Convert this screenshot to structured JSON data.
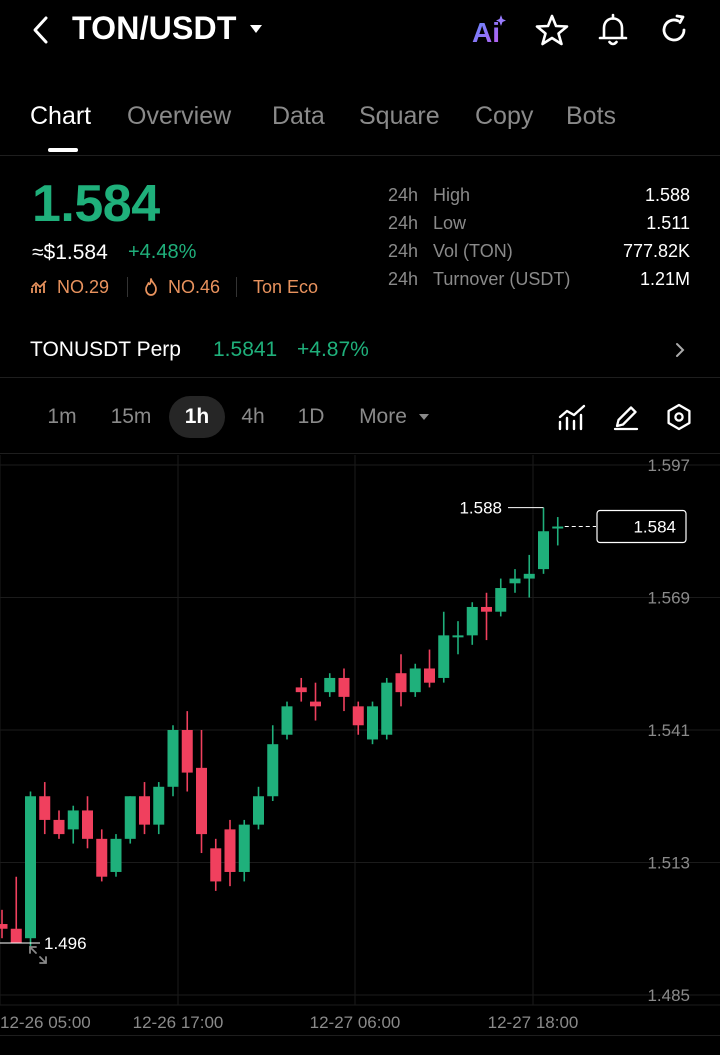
{
  "header": {
    "pair": "TON/USDT",
    "icons": [
      "back-icon",
      "caret-down-icon",
      "ai-icon",
      "star-icon",
      "bell-icon",
      "refresh-icon"
    ]
  },
  "tabs": [
    {
      "label": "Chart",
      "active": true
    },
    {
      "label": "Overview",
      "active": false
    },
    {
      "label": "Data",
      "active": false
    },
    {
      "label": "Square",
      "active": false
    },
    {
      "label": "Copy",
      "active": false
    },
    {
      "label": "Bots",
      "active": false
    }
  ],
  "ticker": {
    "price": "1.584",
    "usd": "≈$1.584",
    "change": "+4.48%",
    "rank1": "NO.29",
    "rank2": "NO.46",
    "tag": "Ton Eco",
    "stats": [
      {
        "period": "24h",
        "label": "High",
        "value": "1.588"
      },
      {
        "period": "24h",
        "label": "Low",
        "value": "1.511"
      },
      {
        "period": "24h",
        "label": "Vol (TON)",
        "value": "777.82K"
      },
      {
        "period": "24h",
        "label": "Turnover (USDT)",
        "value": "1.21M"
      }
    ]
  },
  "perp": {
    "name": "TONUSDT Perp",
    "price": "1.5841",
    "change": "+4.87%"
  },
  "intervals": [
    {
      "label": "1m",
      "active": false
    },
    {
      "label": "15m",
      "active": false
    },
    {
      "label": "1h",
      "active": true
    },
    {
      "label": "4h",
      "active": false
    },
    {
      "label": "1D",
      "active": false
    },
    {
      "label": "More",
      "active": false
    }
  ],
  "colors": {
    "up": "#1fb07b",
    "down": "#f0405e",
    "rank": "#e9935e",
    "ai": "#8a6cf5"
  },
  "chart_data": {
    "type": "candlestick",
    "x_ticks": [
      "12-26 05:00",
      "12-26 17:00",
      "12-27 06:00",
      "12-27 18:00"
    ],
    "y_ticks": [
      1.597,
      1.569,
      1.541,
      1.513,
      1.485
    ],
    "ylim": [
      1.485,
      1.597
    ],
    "high_label": "1.588",
    "low_label": "1.496",
    "last_price": "1.584",
    "candles": [
      {
        "o": 1.5,
        "h": 1.503,
        "l": 1.497,
        "c": 1.499
      },
      {
        "o": 1.499,
        "h": 1.51,
        "l": 1.496,
        "c": 1.496
      },
      {
        "o": 1.497,
        "h": 1.528,
        "l": 1.495,
        "c": 1.527
      },
      {
        "o": 1.527,
        "h": 1.53,
        "l": 1.519,
        "c": 1.522
      },
      {
        "o": 1.522,
        "h": 1.524,
        "l": 1.518,
        "c": 1.519
      },
      {
        "o": 1.52,
        "h": 1.525,
        "l": 1.517,
        "c": 1.524
      },
      {
        "o": 1.524,
        "h": 1.527,
        "l": 1.516,
        "c": 1.518
      },
      {
        "o": 1.518,
        "h": 1.52,
        "l": 1.509,
        "c": 1.51
      },
      {
        "o": 1.511,
        "h": 1.519,
        "l": 1.51,
        "c": 1.518
      },
      {
        "o": 1.518,
        "h": 1.527,
        "l": 1.517,
        "c": 1.527
      },
      {
        "o": 1.527,
        "h": 1.53,
        "l": 1.519,
        "c": 1.521
      },
      {
        "o": 1.521,
        "h": 1.53,
        "l": 1.519,
        "c": 1.529
      },
      {
        "o": 1.529,
        "h": 1.542,
        "l": 1.527,
        "c": 1.541
      },
      {
        "o": 1.541,
        "h": 1.545,
        "l": 1.528,
        "c": 1.532
      },
      {
        "o": 1.533,
        "h": 1.541,
        "l": 1.515,
        "c": 1.519
      },
      {
        "o": 1.516,
        "h": 1.518,
        "l": 1.507,
        "c": 1.509
      },
      {
        "o": 1.52,
        "h": 1.522,
        "l": 1.508,
        "c": 1.511
      },
      {
        "o": 1.511,
        "h": 1.522,
        "l": 1.509,
        "c": 1.521
      },
      {
        "o": 1.521,
        "h": 1.529,
        "l": 1.52,
        "c": 1.527
      },
      {
        "o": 1.527,
        "h": 1.542,
        "l": 1.526,
        "c": 1.538
      },
      {
        "o": 1.54,
        "h": 1.547,
        "l": 1.539,
        "c": 1.546
      },
      {
        "o": 1.55,
        "h": 1.552,
        "l": 1.547,
        "c": 1.549
      },
      {
        "o": 1.547,
        "h": 1.551,
        "l": 1.543,
        "c": 1.546
      },
      {
        "o": 1.549,
        "h": 1.553,
        "l": 1.548,
        "c": 1.552
      },
      {
        "o": 1.552,
        "h": 1.554,
        "l": 1.545,
        "c": 1.548
      },
      {
        "o": 1.546,
        "h": 1.547,
        "l": 1.54,
        "c": 1.542
      },
      {
        "o": 1.539,
        "h": 1.547,
        "l": 1.538,
        "c": 1.546
      },
      {
        "o": 1.54,
        "h": 1.552,
        "l": 1.539,
        "c": 1.551
      },
      {
        "o": 1.553,
        "h": 1.557,
        "l": 1.546,
        "c": 1.549
      },
      {
        "o": 1.549,
        "h": 1.555,
        "l": 1.548,
        "c": 1.554
      },
      {
        "o": 1.554,
        "h": 1.558,
        "l": 1.55,
        "c": 1.551
      },
      {
        "o": 1.552,
        "h": 1.566,
        "l": 1.551,
        "c": 1.561
      },
      {
        "o": 1.561,
        "h": 1.564,
        "l": 1.557,
        "c": 1.561
      },
      {
        "o": 1.561,
        "h": 1.568,
        "l": 1.559,
        "c": 1.567
      },
      {
        "o": 1.567,
        "h": 1.57,
        "l": 1.56,
        "c": 1.566
      },
      {
        "o": 1.566,
        "h": 1.573,
        "l": 1.565,
        "c": 1.571
      },
      {
        "o": 1.572,
        "h": 1.575,
        "l": 1.57,
        "c": 1.573
      },
      {
        "o": 1.573,
        "h": 1.578,
        "l": 1.569,
        "c": 1.574
      },
      {
        "o": 1.575,
        "h": 1.588,
        "l": 1.574,
        "c": 1.583
      },
      {
        "o": 1.584,
        "h": 1.586,
        "l": 1.58,
        "c": 1.584
      }
    ]
  }
}
